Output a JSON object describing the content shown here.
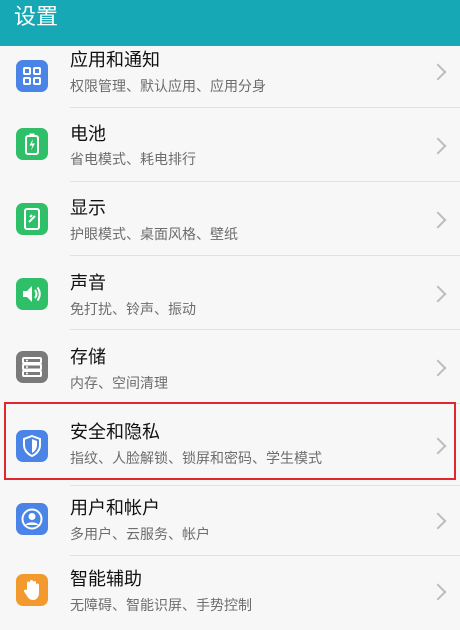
{
  "header": {
    "title": "设置"
  },
  "items": [
    {
      "title": "应用和通知",
      "subtitle": "权限管理、默认应用、应用分身",
      "icon": "apps-grid-icon",
      "color": "#4a84e6"
    },
    {
      "title": "电池",
      "subtitle": "省电模式、耗电排行",
      "icon": "battery-icon",
      "color": "#2fbf68"
    },
    {
      "title": "显示",
      "subtitle": "护眼模式、桌面风格、壁纸",
      "icon": "display-icon",
      "color": "#2fbf68"
    },
    {
      "title": "声音",
      "subtitle": "免打扰、铃声、振动",
      "icon": "speaker-icon",
      "color": "#2fbf68"
    },
    {
      "title": "存储",
      "subtitle": "内存、空间清理",
      "icon": "storage-icon",
      "color": "#7a7a7a"
    },
    {
      "title": "安全和隐私",
      "subtitle": "指纹、人脸解锁、锁屏和密码、学生模式",
      "icon": "shield-icon",
      "color": "#4a84e6"
    },
    {
      "title": "用户和帐户",
      "subtitle": "多用户、云服务、帐户",
      "icon": "user-icon",
      "color": "#4a84e6"
    },
    {
      "title": "智能辅助",
      "subtitle": "无障碍、智能识屏、手势控制",
      "icon": "hand-icon",
      "color": "#f29a2e"
    }
  ],
  "highlight_color": "#e0262e",
  "header_color": "#16a9b5"
}
